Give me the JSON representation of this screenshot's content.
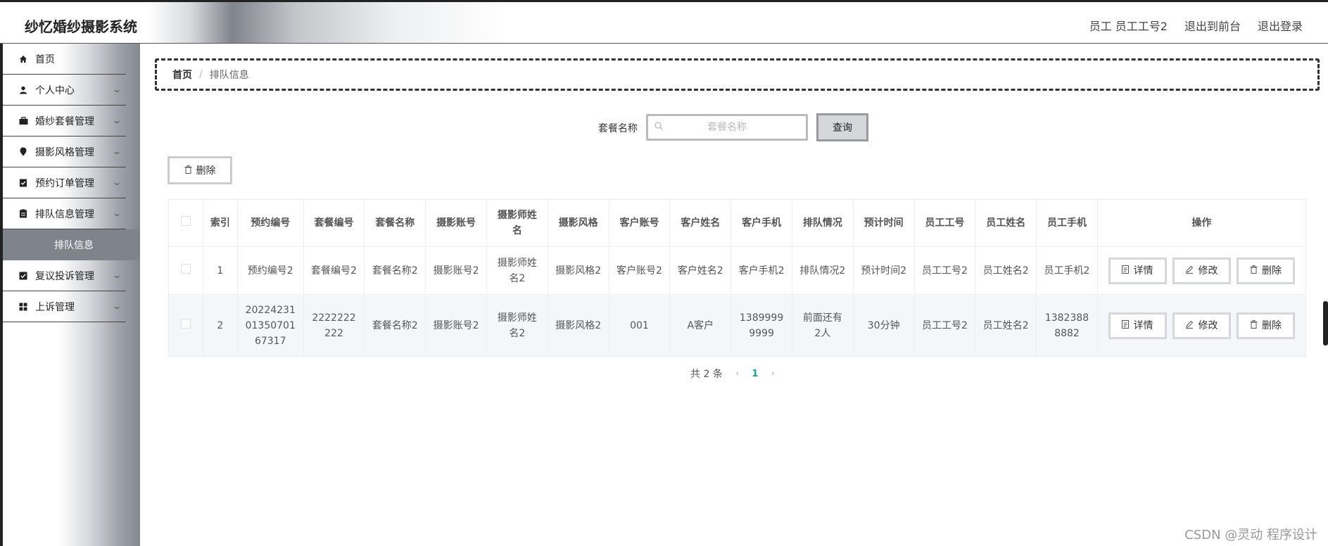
{
  "app": {
    "title": "纱忆婚纱摄影系统"
  },
  "header": {
    "user": "员工 员工工号2",
    "front": "退出到前台",
    "logout": "退出登录"
  },
  "sidebar": {
    "items": [
      {
        "label": "首页",
        "icon": "home-icon",
        "expandable": false
      },
      {
        "label": "个人中心",
        "icon": "user-icon",
        "expandable": true
      },
      {
        "label": "婚纱套餐管理",
        "icon": "briefcase-icon",
        "expandable": true
      },
      {
        "label": "摄影风格管理",
        "icon": "pin-icon",
        "expandable": true
      },
      {
        "label": "预约订单管理",
        "icon": "clipboard-check-icon",
        "expandable": true
      },
      {
        "label": "排队信息管理",
        "icon": "clipboard-icon",
        "expandable": true
      },
      {
        "label": "复议投诉管理",
        "icon": "checkbox-icon",
        "expandable": true
      },
      {
        "label": "上诉管理",
        "icon": "grid-icon",
        "expandable": true
      }
    ],
    "active_sub": "排队信息"
  },
  "breadcrumb": {
    "home": "首页",
    "sep": "/",
    "current": "排队信息"
  },
  "search": {
    "label": "套餐名称",
    "placeholder": "套餐名称",
    "button": "查询"
  },
  "toolbar": {
    "delete": "删除"
  },
  "table": {
    "headers": [
      "索引",
      "预约编号",
      "套餐编号",
      "套餐名称",
      "摄影账号",
      "摄影师姓名",
      "摄影风格",
      "客户账号",
      "客户姓名",
      "客户手机",
      "排队情况",
      "预计时间",
      "员工工号",
      "员工姓名",
      "员工手机",
      "操作"
    ],
    "rows": [
      [
        "1",
        "预约编号2",
        "套餐编号2",
        "套餐名称2",
        "摄影账号2",
        "摄影师姓名2",
        "摄影风格2",
        "客户账号2",
        "客户姓名2",
        "客户手机2",
        "排队情况2",
        "预计时间2",
        "员工工号2",
        "员工姓名2",
        "员工手机2"
      ],
      [
        "2",
        "202242310135070167317",
        "2222222222",
        "套餐名称2",
        "摄影账号2",
        "摄影师姓名2",
        "摄影风格2",
        "001",
        "A客户",
        "13899999999",
        "前面还有2人",
        "30分钟",
        "员工工号2",
        "员工姓名2",
        "13823888882"
      ]
    ],
    "actions": {
      "detail": "详情",
      "edit": "修改",
      "delete": "删除"
    }
  },
  "pagination": {
    "total": "共 2 条",
    "prev": "‹",
    "page": "1",
    "next": "›"
  },
  "watermark": "CSDN @灵动 程序设计"
}
